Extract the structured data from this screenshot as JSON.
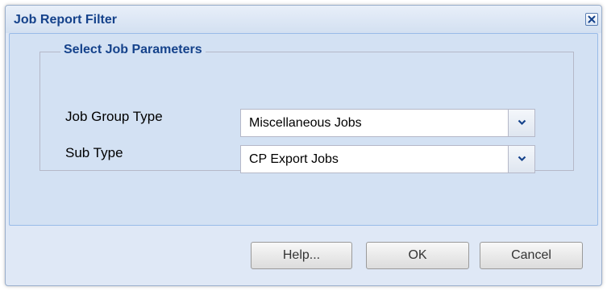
{
  "dialog": {
    "title": "Job Report Filter"
  },
  "fieldset": {
    "legend": "Select Job Parameters"
  },
  "fields": [
    {
      "label": "Job Group Type",
      "value": "Miscellaneous Jobs"
    },
    {
      "label": "Sub Type",
      "value": "CP Export Jobs"
    }
  ],
  "buttons": {
    "help": "Help...",
    "ok": "OK",
    "cancel": "Cancel"
  },
  "icons": {
    "close": "close-icon",
    "dropdown": "chevron-down-icon"
  },
  "colors": {
    "title_text": "#15428b",
    "dialog_bg": "#dfe8f6",
    "panel_bg": "#d3e1f3",
    "accent_border": "#99bbe8"
  }
}
